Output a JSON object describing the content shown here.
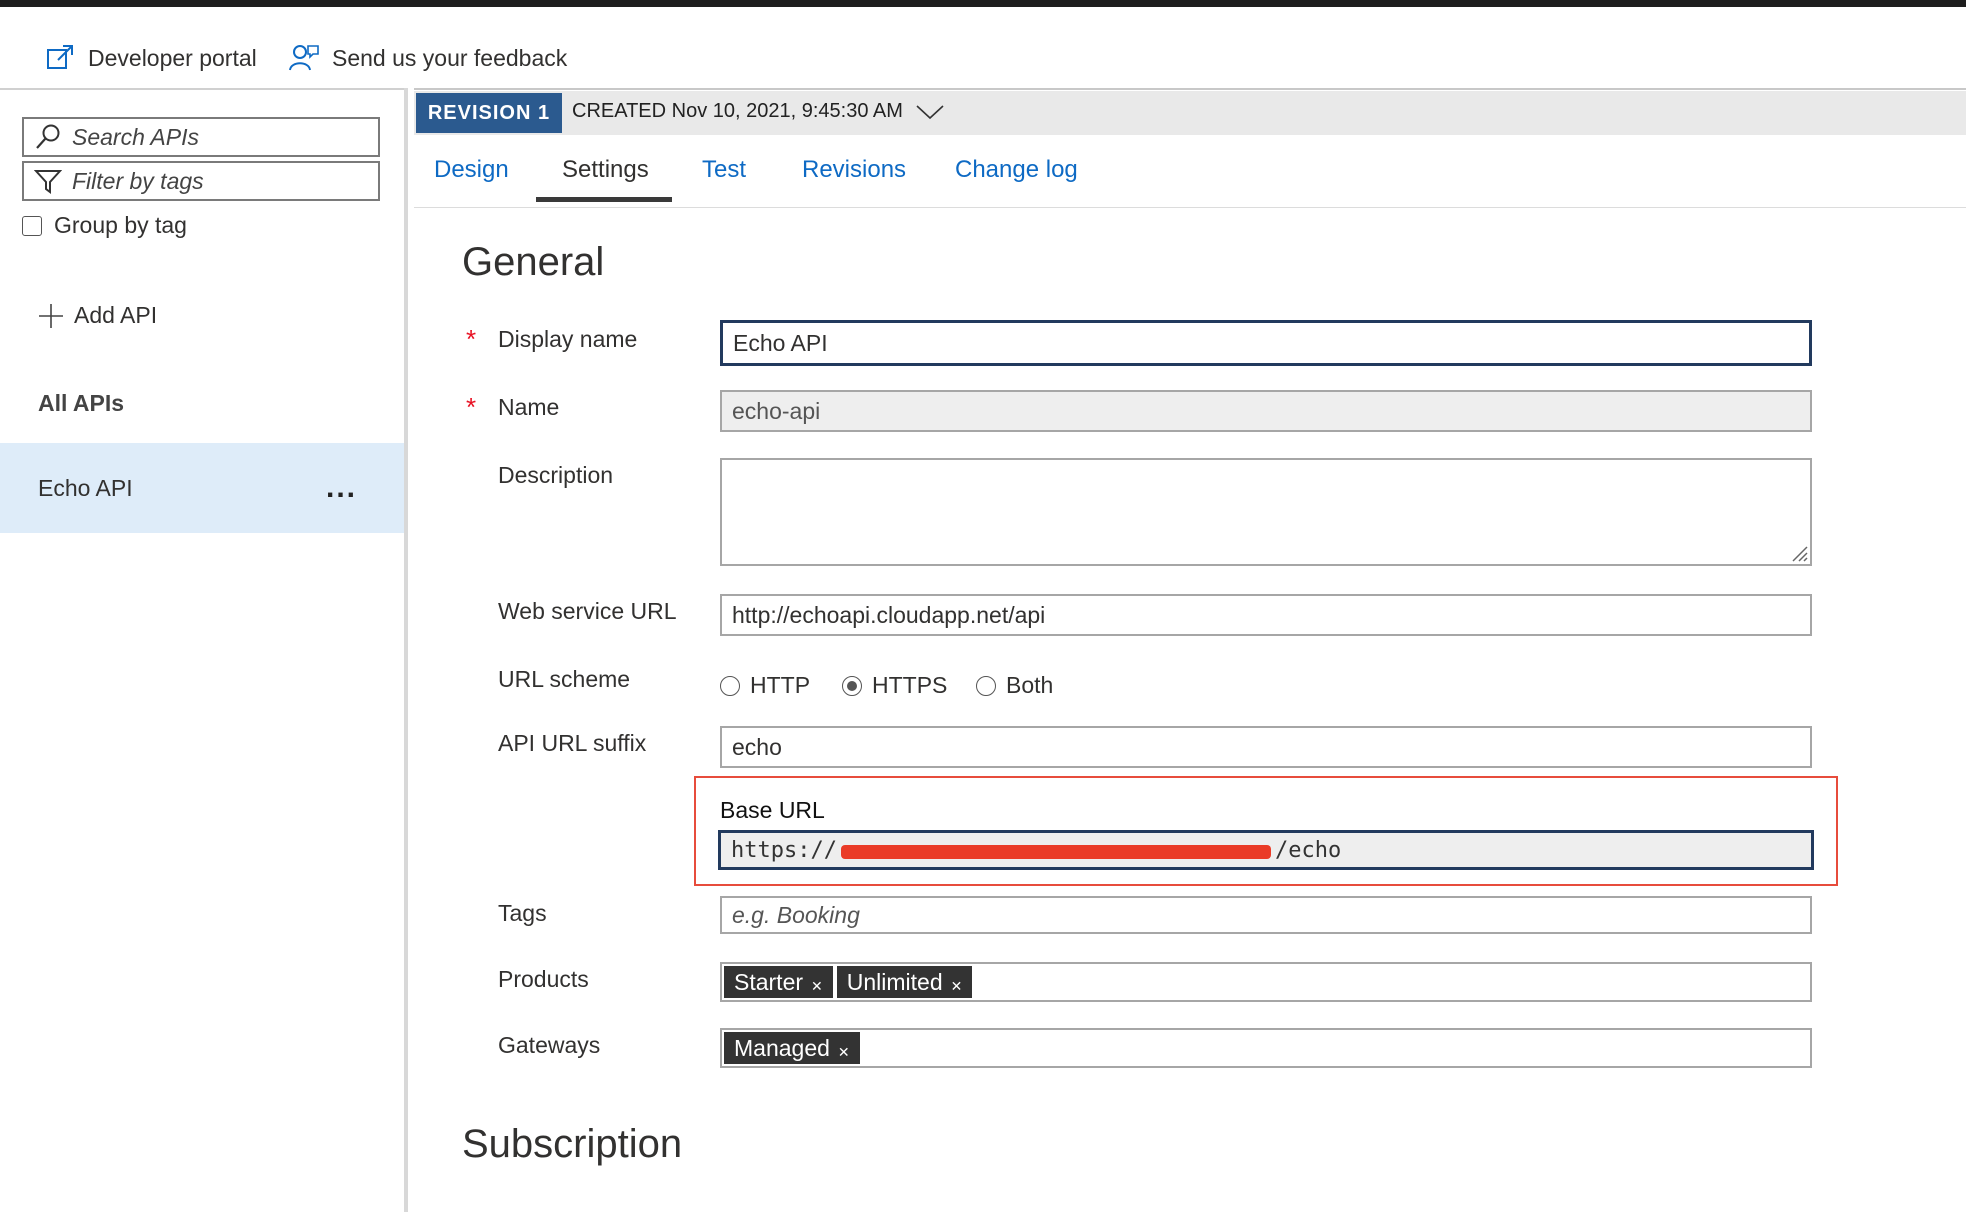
{
  "top": {
    "developer_portal": "Developer portal",
    "feedback": "Send us your feedback"
  },
  "sidebar": {
    "search_placeholder": "Search APIs",
    "filter_placeholder": "Filter by tags",
    "group_by_tag": "Group by tag",
    "add_api": "Add API",
    "all_apis": "All APIs",
    "items": [
      {
        "label": "Echo API",
        "more": "..."
      }
    ]
  },
  "revision": {
    "badge": "REVISION 1",
    "created": "CREATED Nov 10, 2021, 9:45:30 AM"
  },
  "tabs": [
    {
      "label": "Design"
    },
    {
      "label": "Settings",
      "active": true
    },
    {
      "label": "Test"
    },
    {
      "label": "Revisions"
    },
    {
      "label": "Change log"
    }
  ],
  "general": {
    "title": "General",
    "required_mark": "*",
    "display_name": {
      "label": "Display name",
      "value": "Echo API"
    },
    "name": {
      "label": "Name",
      "value": "echo-api"
    },
    "description": {
      "label": "Description",
      "value": ""
    },
    "web_service_url": {
      "label": "Web service URL",
      "value": "http://echoapi.cloudapp.net/api"
    },
    "url_scheme": {
      "label": "URL scheme",
      "options": [
        "HTTP",
        "HTTPS",
        "Both"
      ],
      "selected": "HTTPS"
    },
    "api_url_suffix": {
      "label": "API URL suffix",
      "value": "echo"
    },
    "base_url": {
      "label": "Base URL",
      "prefix": "https://",
      "suffix": "/echo"
    },
    "tags": {
      "label": "Tags",
      "placeholder": "e.g. Booking"
    },
    "products": {
      "label": "Products",
      "chips": [
        "Starter",
        "Unlimited"
      ]
    },
    "gateways": {
      "label": "Gateways",
      "chips": [
        "Managed"
      ]
    }
  },
  "subscription": {
    "title": "Subscription"
  },
  "colors": {
    "accent_link": "#0e6ac4",
    "revision_badge": "#2b5a8f",
    "selected_item": "#deecf9",
    "highlight_border": "#e74c3c",
    "required": "#e81123"
  }
}
